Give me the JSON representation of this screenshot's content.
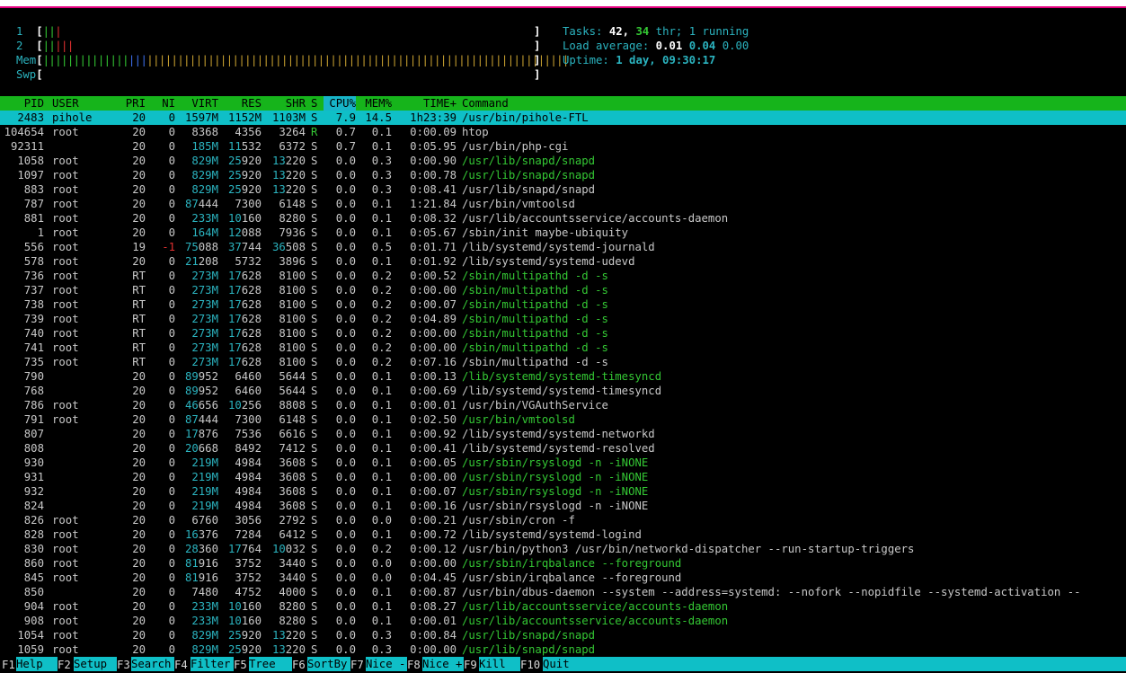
{
  "meters": {
    "cpu1": {
      "label": "1",
      "green": "||",
      "red": "|"
    },
    "cpu2": {
      "label": "2",
      "green": "||",
      "red": "|||"
    },
    "mem": {
      "label": "Mem",
      "green": "||||||||||||||",
      "blue": "|||",
      "yellow": "|||||||||||||||||||||||||||||||||||||||||||||||||||||||||||||||||||||"
    },
    "swp": {
      "label": "Swp"
    },
    "lbracket": "[",
    "rbracket": "]"
  },
  "summary": {
    "tasks_label": "Tasks:",
    "tasks": "42,",
    "threads": "34",
    "threads_label": "thr;",
    "running": "1 running",
    "load_label": "Load average:",
    "load1": "0.01",
    "load5": "0.04",
    "load15": "0.00",
    "uptime_label": "Uptime:",
    "uptime": "1 day, 09:30:17"
  },
  "columns": {
    "pid": "PID",
    "user": "USER",
    "pri": "PRI",
    "ni": "NI",
    "virt": "VIRT",
    "res": "RES",
    "shr": "SHR",
    "s": "S",
    "cpu": "CPU%",
    "mem": "MEM%",
    "time": "TIME+",
    "cmd": "Command"
  },
  "processes": [
    {
      "pid": "2483",
      "user": "pihole",
      "pri": "20",
      "ni": "0",
      "virt": "1597M",
      "res": "1152M",
      "shr": "1103M",
      "s": "S",
      "cpu": "7.9",
      "mem": "14.5",
      "time": "1h23:39",
      "cmd": "/usr/bin/pihole-FTL",
      "selected": true
    },
    {
      "pid": "104654",
      "user": "root",
      "pri": "20",
      "ni": "0",
      "virt": "8368",
      "res": "4356",
      "shr": "3264",
      "s": "R",
      "cpu": "0.7",
      "mem": "0.1",
      "time": "0:00.09",
      "cmd": "htop"
    },
    {
      "pid": "92311",
      "user": "",
      "pri": "20",
      "ni": "0",
      "virt": "185M",
      "res": "11532",
      "shr": "6372",
      "s": "S",
      "cpu": "0.7",
      "mem": "0.1",
      "time": "0:05.95",
      "cmd": "/usr/bin/php-cgi"
    },
    {
      "pid": "1058",
      "user": "root",
      "pri": "20",
      "ni": "0",
      "virt": "829M",
      "res": "25920",
      "shr": "13220",
      "s": "S",
      "cpu": "0.0",
      "mem": "0.3",
      "time": "0:00.90",
      "cmd": "/usr/lib/snapd/snapd",
      "thread": true
    },
    {
      "pid": "1097",
      "user": "root",
      "pri": "20",
      "ni": "0",
      "virt": "829M",
      "res": "25920",
      "shr": "13220",
      "s": "S",
      "cpu": "0.0",
      "mem": "0.3",
      "time": "0:00.78",
      "cmd": "/usr/lib/snapd/snapd",
      "thread": true
    },
    {
      "pid": "883",
      "user": "root",
      "pri": "20",
      "ni": "0",
      "virt": "829M",
      "res": "25920",
      "shr": "13220",
      "s": "S",
      "cpu": "0.0",
      "mem": "0.3",
      "time": "0:08.41",
      "cmd": "/usr/lib/snapd/snapd"
    },
    {
      "pid": "787",
      "user": "root",
      "pri": "20",
      "ni": "0",
      "virt": "87444",
      "res": "7300",
      "shr": "6148",
      "s": "S",
      "cpu": "0.0",
      "mem": "0.1",
      "time": "1:21.84",
      "cmd": "/usr/bin/vmtoolsd"
    },
    {
      "pid": "881",
      "user": "root",
      "pri": "20",
      "ni": "0",
      "virt": "233M",
      "res": "10160",
      "shr": "8280",
      "s": "S",
      "cpu": "0.0",
      "mem": "0.1",
      "time": "0:08.32",
      "cmd": "/usr/lib/accountsservice/accounts-daemon"
    },
    {
      "pid": "1",
      "user": "root",
      "pri": "20",
      "ni": "0",
      "virt": "164M",
      "res": "12088",
      "shr": "7936",
      "s": "S",
      "cpu": "0.0",
      "mem": "0.1",
      "time": "0:05.67",
      "cmd": "/sbin/init maybe-ubiquity"
    },
    {
      "pid": "556",
      "user": "root",
      "pri": "19",
      "ni": "-1",
      "virt": "75088",
      "res": "37744",
      "shr": "36508",
      "s": "S",
      "cpu": "0.0",
      "mem": "0.5",
      "time": "0:01.71",
      "cmd": "/lib/systemd/systemd-journald"
    },
    {
      "pid": "578",
      "user": "root",
      "pri": "20",
      "ni": "0",
      "virt": "21208",
      "res": "5732",
      "shr": "3896",
      "s": "S",
      "cpu": "0.0",
      "mem": "0.1",
      "time": "0:01.92",
      "cmd": "/lib/systemd/systemd-udevd"
    },
    {
      "pid": "736",
      "user": "root",
      "pri": "RT",
      "ni": "0",
      "virt": "273M",
      "res": "17628",
      "shr": "8100",
      "s": "S",
      "cpu": "0.0",
      "mem": "0.2",
      "time": "0:00.52",
      "cmd": "/sbin/multipathd -d -s",
      "thread": true
    },
    {
      "pid": "737",
      "user": "root",
      "pri": "RT",
      "ni": "0",
      "virt": "273M",
      "res": "17628",
      "shr": "8100",
      "s": "S",
      "cpu": "0.0",
      "mem": "0.2",
      "time": "0:00.00",
      "cmd": "/sbin/multipathd -d -s",
      "thread": true
    },
    {
      "pid": "738",
      "user": "root",
      "pri": "RT",
      "ni": "0",
      "virt": "273M",
      "res": "17628",
      "shr": "8100",
      "s": "S",
      "cpu": "0.0",
      "mem": "0.2",
      "time": "0:00.07",
      "cmd": "/sbin/multipathd -d -s",
      "thread": true
    },
    {
      "pid": "739",
      "user": "root",
      "pri": "RT",
      "ni": "0",
      "virt": "273M",
      "res": "17628",
      "shr": "8100",
      "s": "S",
      "cpu": "0.0",
      "mem": "0.2",
      "time": "0:04.89",
      "cmd": "/sbin/multipathd -d -s",
      "thread": true
    },
    {
      "pid": "740",
      "user": "root",
      "pri": "RT",
      "ni": "0",
      "virt": "273M",
      "res": "17628",
      "shr": "8100",
      "s": "S",
      "cpu": "0.0",
      "mem": "0.2",
      "time": "0:00.00",
      "cmd": "/sbin/multipathd -d -s",
      "thread": true
    },
    {
      "pid": "741",
      "user": "root",
      "pri": "RT",
      "ni": "0",
      "virt": "273M",
      "res": "17628",
      "shr": "8100",
      "s": "S",
      "cpu": "0.0",
      "mem": "0.2",
      "time": "0:00.00",
      "cmd": "/sbin/multipathd -d -s",
      "thread": true
    },
    {
      "pid": "735",
      "user": "root",
      "pri": "RT",
      "ni": "0",
      "virt": "273M",
      "res": "17628",
      "shr": "8100",
      "s": "S",
      "cpu": "0.0",
      "mem": "0.2",
      "time": "0:07.16",
      "cmd": "/sbin/multipathd -d -s"
    },
    {
      "pid": "790",
      "user": "",
      "pri": "20",
      "ni": "0",
      "virt": "89952",
      "res": "6460",
      "shr": "5644",
      "s": "S",
      "cpu": "0.0",
      "mem": "0.1",
      "time": "0:00.13",
      "cmd": "/lib/systemd/systemd-timesyncd",
      "thread": true
    },
    {
      "pid": "768",
      "user": "",
      "pri": "20",
      "ni": "0",
      "virt": "89952",
      "res": "6460",
      "shr": "5644",
      "s": "S",
      "cpu": "0.0",
      "mem": "0.1",
      "time": "0:00.69",
      "cmd": "/lib/systemd/systemd-timesyncd"
    },
    {
      "pid": "786",
      "user": "root",
      "pri": "20",
      "ni": "0",
      "virt": "46656",
      "res": "10256",
      "shr": "8808",
      "s": "S",
      "cpu": "0.0",
      "mem": "0.1",
      "time": "0:00.01",
      "cmd": "/usr/bin/VGAuthService"
    },
    {
      "pid": "791",
      "user": "root",
      "pri": "20",
      "ni": "0",
      "virt": "87444",
      "res": "7300",
      "shr": "6148",
      "s": "S",
      "cpu": "0.0",
      "mem": "0.1",
      "time": "0:02.50",
      "cmd": "/usr/bin/vmtoolsd",
      "thread": true
    },
    {
      "pid": "807",
      "user": "",
      "pri": "20",
      "ni": "0",
      "virt": "17876",
      "res": "7536",
      "shr": "6616",
      "s": "S",
      "cpu": "0.0",
      "mem": "0.1",
      "time": "0:00.92",
      "cmd": "/lib/systemd/systemd-networkd"
    },
    {
      "pid": "808",
      "user": "",
      "pri": "20",
      "ni": "0",
      "virt": "20668",
      "res": "8492",
      "shr": "7412",
      "s": "S",
      "cpu": "0.0",
      "mem": "0.1",
      "time": "0:00.41",
      "cmd": "/lib/systemd/systemd-resolved"
    },
    {
      "pid": "930",
      "user": "",
      "pri": "20",
      "ni": "0",
      "virt": "219M",
      "res": "4984",
      "shr": "3608",
      "s": "S",
      "cpu": "0.0",
      "mem": "0.1",
      "time": "0:00.05",
      "cmd": "/usr/sbin/rsyslogd -n -iNONE",
      "thread": true
    },
    {
      "pid": "931",
      "user": "",
      "pri": "20",
      "ni": "0",
      "virt": "219M",
      "res": "4984",
      "shr": "3608",
      "s": "S",
      "cpu": "0.0",
      "mem": "0.1",
      "time": "0:00.00",
      "cmd": "/usr/sbin/rsyslogd -n -iNONE",
      "thread": true
    },
    {
      "pid": "932",
      "user": "",
      "pri": "20",
      "ni": "0",
      "virt": "219M",
      "res": "4984",
      "shr": "3608",
      "s": "S",
      "cpu": "0.0",
      "mem": "0.1",
      "time": "0:00.07",
      "cmd": "/usr/sbin/rsyslogd -n -iNONE",
      "thread": true
    },
    {
      "pid": "824",
      "user": "",
      "pri": "20",
      "ni": "0",
      "virt": "219M",
      "res": "4984",
      "shr": "3608",
      "s": "S",
      "cpu": "0.0",
      "mem": "0.1",
      "time": "0:00.16",
      "cmd": "/usr/sbin/rsyslogd -n -iNONE"
    },
    {
      "pid": "826",
      "user": "root",
      "pri": "20",
      "ni": "0",
      "virt": "6760",
      "res": "3056",
      "shr": "2792",
      "s": "S",
      "cpu": "0.0",
      "mem": "0.0",
      "time": "0:00.21",
      "cmd": "/usr/sbin/cron -f"
    },
    {
      "pid": "828",
      "user": "root",
      "pri": "20",
      "ni": "0",
      "virt": "16376",
      "res": "7284",
      "shr": "6412",
      "s": "S",
      "cpu": "0.0",
      "mem": "0.1",
      "time": "0:00.72",
      "cmd": "/lib/systemd/systemd-logind"
    },
    {
      "pid": "830",
      "user": "root",
      "pri": "20",
      "ni": "0",
      "virt": "28360",
      "res": "17764",
      "shr": "10032",
      "s": "S",
      "cpu": "0.0",
      "mem": "0.2",
      "time": "0:00.12",
      "cmd": "/usr/bin/python3 /usr/bin/networkd-dispatcher --run-startup-triggers"
    },
    {
      "pid": "860",
      "user": "root",
      "pri": "20",
      "ni": "0",
      "virt": "81916",
      "res": "3752",
      "shr": "3440",
      "s": "S",
      "cpu": "0.0",
      "mem": "0.0",
      "time": "0:00.00",
      "cmd": "/usr/sbin/irqbalance --foreground",
      "thread": true
    },
    {
      "pid": "845",
      "user": "root",
      "pri": "20",
      "ni": "0",
      "virt": "81916",
      "res": "3752",
      "shr": "3440",
      "s": "S",
      "cpu": "0.0",
      "mem": "0.0",
      "time": "0:04.45",
      "cmd": "/usr/sbin/irqbalance --foreground"
    },
    {
      "pid": "850",
      "user": "",
      "pri": "20",
      "ni": "0",
      "virt": "7480",
      "res": "4752",
      "shr": "4000",
      "s": "S",
      "cpu": "0.0",
      "mem": "0.1",
      "time": "0:00.87",
      "cmd": "/usr/bin/dbus-daemon --system --address=systemd: --nofork --nopidfile --systemd-activation --"
    },
    {
      "pid": "904",
      "user": "root",
      "pri": "20",
      "ni": "0",
      "virt": "233M",
      "res": "10160",
      "shr": "8280",
      "s": "S",
      "cpu": "0.0",
      "mem": "0.1",
      "time": "0:08.27",
      "cmd": "/usr/lib/accountsservice/accounts-daemon",
      "thread": true
    },
    {
      "pid": "908",
      "user": "root",
      "pri": "20",
      "ni": "0",
      "virt": "233M",
      "res": "10160",
      "shr": "8280",
      "s": "S",
      "cpu": "0.0",
      "mem": "0.1",
      "time": "0:00.01",
      "cmd": "/usr/lib/accountsservice/accounts-daemon",
      "thread": true
    },
    {
      "pid": "1054",
      "user": "root",
      "pri": "20",
      "ni": "0",
      "virt": "829M",
      "res": "25920",
      "shr": "13220",
      "s": "S",
      "cpu": "0.0",
      "mem": "0.3",
      "time": "0:00.84",
      "cmd": "/usr/lib/snapd/snapd",
      "thread": true
    },
    {
      "pid": "1059",
      "user": "root",
      "pri": "20",
      "ni": "0",
      "virt": "829M",
      "res": "25920",
      "shr": "13220",
      "s": "S",
      "cpu": "0.0",
      "mem": "0.3",
      "time": "0:00.00",
      "cmd": "/usr/lib/snapd/snapd",
      "thread": true
    }
  ],
  "footer": [
    {
      "key": "F1",
      "label": "Help"
    },
    {
      "key": "F2",
      "label": "Setup"
    },
    {
      "key": "F3",
      "label": "Search"
    },
    {
      "key": "F4",
      "label": "Filter"
    },
    {
      "key": "F5",
      "label": "Tree"
    },
    {
      "key": "F6",
      "label": "SortBy"
    },
    {
      "key": "F7",
      "label": "Nice -"
    },
    {
      "key": "F8",
      "label": "Nice +"
    },
    {
      "key": "F9",
      "label": "Kill"
    },
    {
      "key": "F10",
      "label": "Quit"
    }
  ],
  "colors": {
    "header_bg": "#16b41b",
    "selected_bg": "#0fbfc7",
    "thread_text": "#34c834",
    "mid_digits": "#2bb4c0",
    "footer_label_bg": "#0fbfc7"
  }
}
